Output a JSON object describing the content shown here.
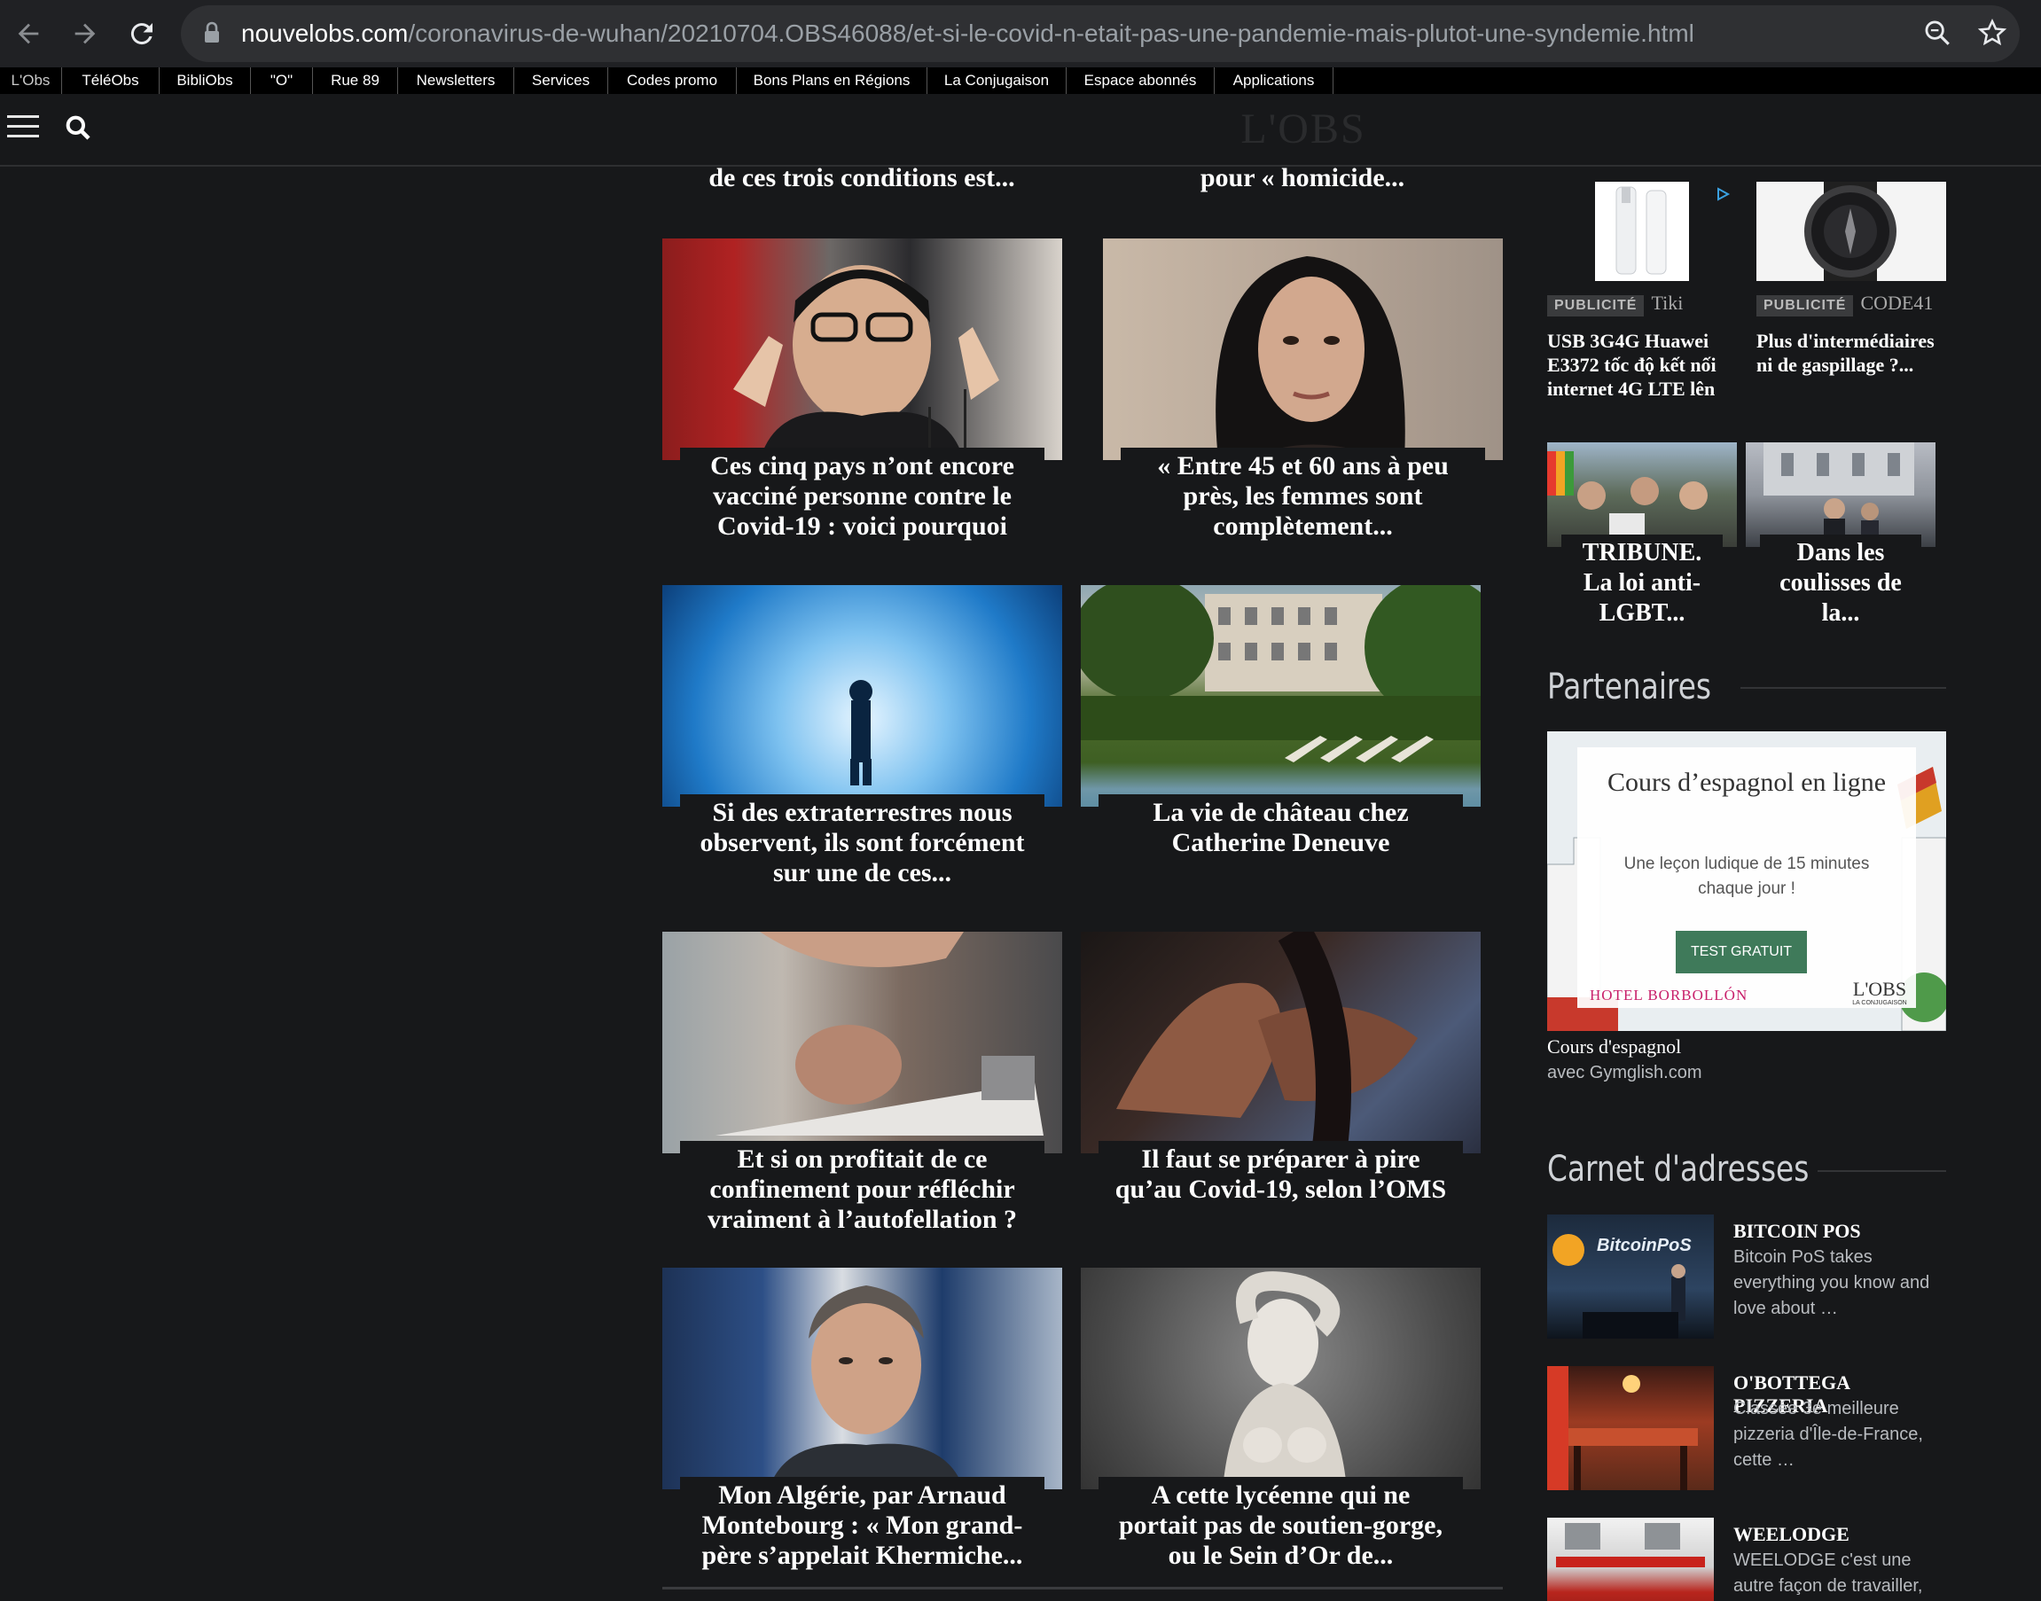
{
  "browser": {
    "url_domain": "nouvelobs.com",
    "url_path": "/coronavirus-de-wuhan/20210704.OBS46088/et-si-le-covid-n-etait-pas-une-pandemie-mais-plutot-une-syndemie.html"
  },
  "linkbar": {
    "items": [
      "L'Obs",
      "TéléObs",
      "BibliObs",
      "\"O\"",
      "Rue 89",
      "Newsletters",
      "Services",
      "Codes promo",
      "Bons Plans en Régions",
      "La Conjugaison",
      "Espace abonnés",
      "Applications"
    ]
  },
  "site": {
    "logo": "L'OBS"
  },
  "articles": {
    "top_left_cut": "de ces trois conditions est...",
    "top_right_cut": "pour « homicide...",
    "items": [
      {
        "title": "Ces cinq pays n’ont encore vacciné personne contre le Covid-19 : voici pourquoi"
      },
      {
        "title": "« Entre 45 et 60 ans à peu près, les femmes sont complètement..."
      },
      {
        "title": "Si des extraterrestres nous observent, ils sont forcément sur une de ces..."
      },
      {
        "title": "La vie de château chez Catherine Deneuve"
      },
      {
        "title": "Et si on profitait de ce confinement pour réfléchir vraiment à l’autofellation ?"
      },
      {
        "title": "Il faut se préparer à pire qu’au Covid-19, selon l’OMS"
      },
      {
        "title": "Mon Algérie, par Arnaud Montebourg : « Mon grand-père s’appelait Khermiche..."
      },
      {
        "title": "A cette lycéenne qui ne portait pas de soutien-gorge, ou le Sein d’Or de..."
      }
    ]
  },
  "sidebar": {
    "ads": [
      {
        "badge": "PUBLICITÉ",
        "brand": "Tiki",
        "title": "USB 3G4G Huawei E3372 tốc độ kết nối internet 4G LTE lên"
      },
      {
        "badge": "PUBLICITÉ",
        "brand": "CODE41",
        "title": "Plus d'intermédiaires ni de gaspillage ?..."
      }
    ],
    "promos": [
      {
        "title": "TRIBUNE. La loi anti-LGBT..."
      },
      {
        "title": "Dans les coulisses de la..."
      }
    ],
    "partenaires": {
      "heading": "Partenaires",
      "banner_title": "Cours d’espagnol en ligne",
      "banner_sub": "Une leçon ludique de 15 minutes chaque jour !",
      "banner_cta": "TEST GRATUIT",
      "banner_hotel": "HOTEL BORBOLLÓN",
      "banner_logo": "L'OBS",
      "banner_logo_sub": "LA CONJUGAISON",
      "caption": "Cours d'espagnol",
      "caption_sub": "avec Gymglish.com"
    },
    "carnet": {
      "heading": "Carnet d'adresses",
      "items": [
        {
          "name": "BITCOIN POS",
          "desc": "Bitcoin PoS takes everything you know and love about …",
          "thumb_text": "BitcoinPoS"
        },
        {
          "name": "O'BOTTEGA PIZZERIA",
          "desc": "Classée 3e meilleure pizzeria d'Île-de-France, cette …"
        },
        {
          "name": "WEELODGE",
          "desc": "WEELODGE c'est une autre façon de travailler,"
        }
      ]
    }
  }
}
